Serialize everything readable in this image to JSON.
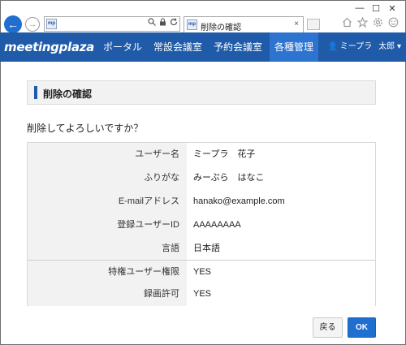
{
  "browser": {
    "tab_title": "削除の確認",
    "favicon_text": "mp",
    "back_glyph": "←",
    "forward_glyph": "→",
    "minimize_glyph": "—",
    "maximize_glyph": "☐",
    "close_glyph": "✕",
    "tab_close_glyph": "×",
    "address_icons": [
      "search-icon",
      "lock-icon",
      "refresh-icon"
    ],
    "tool_icons": [
      "home-icon",
      "star-icon",
      "settings-icon",
      "smiley-icon"
    ]
  },
  "navbar": {
    "logo": "meetingplaza",
    "items": [
      {
        "label": "ポータル",
        "active": false
      },
      {
        "label": "常設会議室",
        "active": false
      },
      {
        "label": "予約会議室",
        "active": false
      },
      {
        "label": "各種管理",
        "active": true
      }
    ],
    "user_name": "ミープラ",
    "user_sub": "太郎 ▾",
    "colors": {
      "bar": "#1f5ba8",
      "active": "#2d74d0"
    }
  },
  "page": {
    "heading": "削除の確認",
    "question": "削除してよろしいですか？",
    "rows": [
      {
        "label": "ユーザー名",
        "value": "ミープラ　花子"
      },
      {
        "label": "ふりがな",
        "value": "みーぷら　はなこ"
      },
      {
        "label": "E-mailアドレス",
        "value": "hanako@example.com"
      },
      {
        "label": "登録ユーザーID",
        "value": "AAAAAAAA"
      },
      {
        "label": "言語",
        "value": "日本語"
      },
      {
        "label": "特権ユーザー権限",
        "value": "YES"
      },
      {
        "label": "録画許可",
        "value": "YES"
      }
    ],
    "back_button": "戻る",
    "ok_button": "OK",
    "accent_color": "#1f6fd0"
  }
}
